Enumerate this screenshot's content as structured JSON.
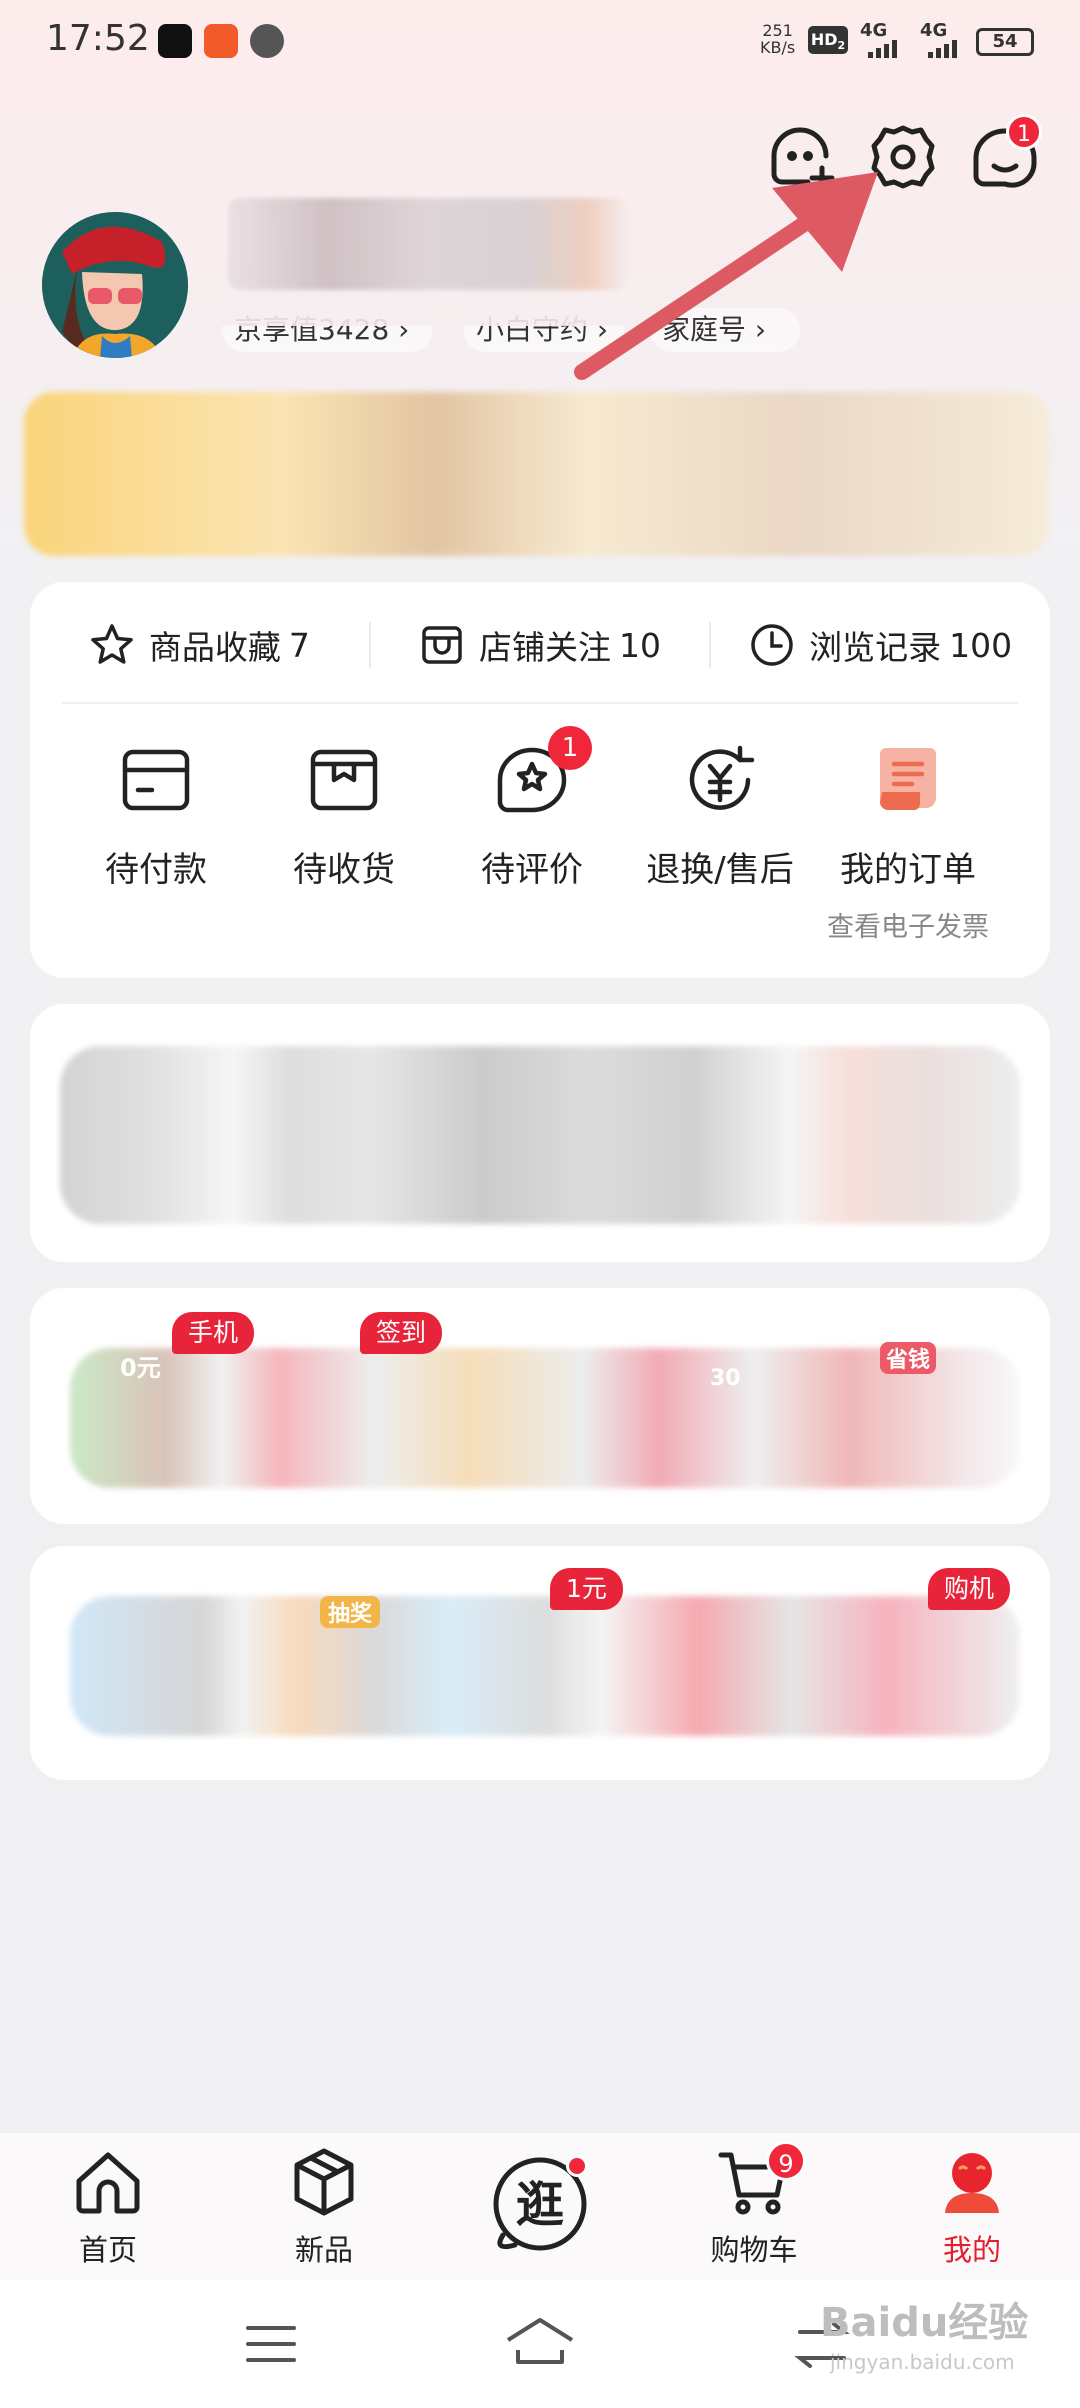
{
  "status_bar": {
    "time": "17:52",
    "net_speed_value": "251",
    "net_speed_unit": "KB/s",
    "hd_label": "HD",
    "hd_sub": "2",
    "signal1": "4G",
    "signal2": "4G",
    "battery": "54"
  },
  "header": {
    "icons": [
      "add-friend-icon",
      "settings-icon",
      "message-icon"
    ],
    "message_badge": "1"
  },
  "profile": {
    "chips": [
      "京享值3428 ›",
      "小白守约 ›",
      "家庭号 ›"
    ]
  },
  "favorites": [
    {
      "label": "商品收藏",
      "count": "7",
      "icon": "star-icon"
    },
    {
      "label": "店铺关注",
      "count": "10",
      "icon": "store-icon"
    },
    {
      "label": "浏览记录",
      "count": "100",
      "icon": "clock-icon"
    }
  ],
  "orders": [
    {
      "label": "待付款",
      "icon": "wallet-icon"
    },
    {
      "label": "待收货",
      "icon": "package-icon"
    },
    {
      "label": "待评价",
      "icon": "review-icon",
      "badge": "1"
    },
    {
      "label": "退换/售后",
      "icon": "refund-icon"
    },
    {
      "label": "我的订单",
      "icon": "order-list-icon",
      "sub": "查看电子发票"
    }
  ],
  "promo_tags": {
    "row2": [
      "手机",
      "签到"
    ],
    "row2_partial": [
      "0元",
      "省钱",
      "30"
    ],
    "row3": [
      "1元",
      "购机"
    ],
    "row3_partial": [
      "抽奖"
    ]
  },
  "bottom_nav": [
    {
      "label": "首页",
      "icon": "home-icon"
    },
    {
      "label": "新品",
      "icon": "cube-icon"
    },
    {
      "label": "逛",
      "icon": "explore-icon"
    },
    {
      "label": "购物车",
      "icon": "cart-icon",
      "badge": "9"
    },
    {
      "label": "我的",
      "icon": "profile-icon",
      "active": true
    }
  ],
  "watermark": {
    "text": "Baidu经验",
    "sub": "jingyan.baidu.com"
  },
  "colors": {
    "accent": "#e51e2e",
    "badge": "#f0273a",
    "arrow": "#dd5a63"
  }
}
